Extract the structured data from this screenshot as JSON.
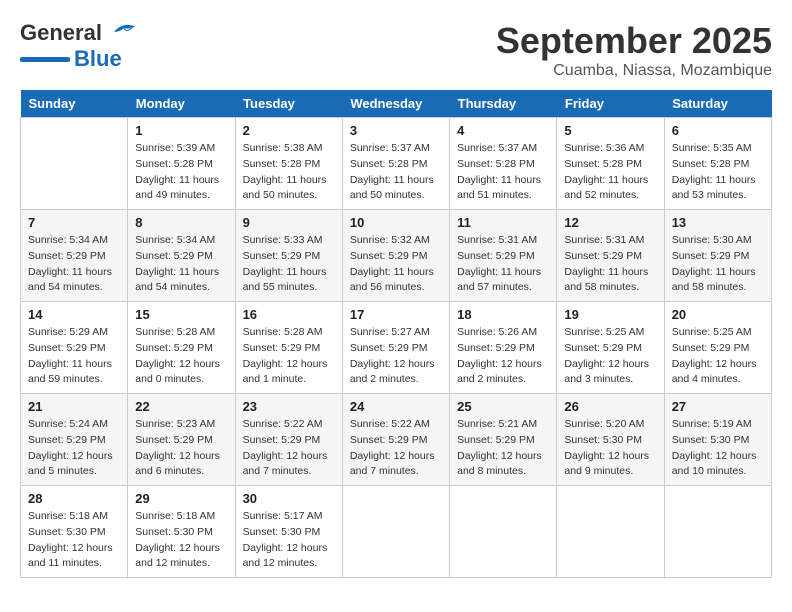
{
  "header": {
    "logo_general": "General",
    "logo_blue": "Blue",
    "month_title": "September 2025",
    "location": "Cuamba, Niassa, Mozambique"
  },
  "weekdays": [
    "Sunday",
    "Monday",
    "Tuesday",
    "Wednesday",
    "Thursday",
    "Friday",
    "Saturday"
  ],
  "weeks": [
    [
      {
        "day": "",
        "sunrise": "",
        "sunset": "",
        "daylight": ""
      },
      {
        "day": "1",
        "sunrise": "Sunrise: 5:39 AM",
        "sunset": "Sunset: 5:28 PM",
        "daylight": "Daylight: 11 hours and 49 minutes."
      },
      {
        "day": "2",
        "sunrise": "Sunrise: 5:38 AM",
        "sunset": "Sunset: 5:28 PM",
        "daylight": "Daylight: 11 hours and 50 minutes."
      },
      {
        "day": "3",
        "sunrise": "Sunrise: 5:37 AM",
        "sunset": "Sunset: 5:28 PM",
        "daylight": "Daylight: 11 hours and 50 minutes."
      },
      {
        "day": "4",
        "sunrise": "Sunrise: 5:37 AM",
        "sunset": "Sunset: 5:28 PM",
        "daylight": "Daylight: 11 hours and 51 minutes."
      },
      {
        "day": "5",
        "sunrise": "Sunrise: 5:36 AM",
        "sunset": "Sunset: 5:28 PM",
        "daylight": "Daylight: 11 hours and 52 minutes."
      },
      {
        "day": "6",
        "sunrise": "Sunrise: 5:35 AM",
        "sunset": "Sunset: 5:28 PM",
        "daylight": "Daylight: 11 hours and 53 minutes."
      }
    ],
    [
      {
        "day": "7",
        "sunrise": "Sunrise: 5:34 AM",
        "sunset": "Sunset: 5:29 PM",
        "daylight": "Daylight: 11 hours and 54 minutes."
      },
      {
        "day": "8",
        "sunrise": "Sunrise: 5:34 AM",
        "sunset": "Sunset: 5:29 PM",
        "daylight": "Daylight: 11 hours and 54 minutes."
      },
      {
        "day": "9",
        "sunrise": "Sunrise: 5:33 AM",
        "sunset": "Sunset: 5:29 PM",
        "daylight": "Daylight: 11 hours and 55 minutes."
      },
      {
        "day": "10",
        "sunrise": "Sunrise: 5:32 AM",
        "sunset": "Sunset: 5:29 PM",
        "daylight": "Daylight: 11 hours and 56 minutes."
      },
      {
        "day": "11",
        "sunrise": "Sunrise: 5:31 AM",
        "sunset": "Sunset: 5:29 PM",
        "daylight": "Daylight: 11 hours and 57 minutes."
      },
      {
        "day": "12",
        "sunrise": "Sunrise: 5:31 AM",
        "sunset": "Sunset: 5:29 PM",
        "daylight": "Daylight: 11 hours and 58 minutes."
      },
      {
        "day": "13",
        "sunrise": "Sunrise: 5:30 AM",
        "sunset": "Sunset: 5:29 PM",
        "daylight": "Daylight: 11 hours and 58 minutes."
      }
    ],
    [
      {
        "day": "14",
        "sunrise": "Sunrise: 5:29 AM",
        "sunset": "Sunset: 5:29 PM",
        "daylight": "Daylight: 11 hours and 59 minutes."
      },
      {
        "day": "15",
        "sunrise": "Sunrise: 5:28 AM",
        "sunset": "Sunset: 5:29 PM",
        "daylight": "Daylight: 12 hours and 0 minutes."
      },
      {
        "day": "16",
        "sunrise": "Sunrise: 5:28 AM",
        "sunset": "Sunset: 5:29 PM",
        "daylight": "Daylight: 12 hours and 1 minute."
      },
      {
        "day": "17",
        "sunrise": "Sunrise: 5:27 AM",
        "sunset": "Sunset: 5:29 PM",
        "daylight": "Daylight: 12 hours and 2 minutes."
      },
      {
        "day": "18",
        "sunrise": "Sunrise: 5:26 AM",
        "sunset": "Sunset: 5:29 PM",
        "daylight": "Daylight: 12 hours and 2 minutes."
      },
      {
        "day": "19",
        "sunrise": "Sunrise: 5:25 AM",
        "sunset": "Sunset: 5:29 PM",
        "daylight": "Daylight: 12 hours and 3 minutes."
      },
      {
        "day": "20",
        "sunrise": "Sunrise: 5:25 AM",
        "sunset": "Sunset: 5:29 PM",
        "daylight": "Daylight: 12 hours and 4 minutes."
      }
    ],
    [
      {
        "day": "21",
        "sunrise": "Sunrise: 5:24 AM",
        "sunset": "Sunset: 5:29 PM",
        "daylight": "Daylight: 12 hours and 5 minutes."
      },
      {
        "day": "22",
        "sunrise": "Sunrise: 5:23 AM",
        "sunset": "Sunset: 5:29 PM",
        "daylight": "Daylight: 12 hours and 6 minutes."
      },
      {
        "day": "23",
        "sunrise": "Sunrise: 5:22 AM",
        "sunset": "Sunset: 5:29 PM",
        "daylight": "Daylight: 12 hours and 7 minutes."
      },
      {
        "day": "24",
        "sunrise": "Sunrise: 5:22 AM",
        "sunset": "Sunset: 5:29 PM",
        "daylight": "Daylight: 12 hours and 7 minutes."
      },
      {
        "day": "25",
        "sunrise": "Sunrise: 5:21 AM",
        "sunset": "Sunset: 5:29 PM",
        "daylight": "Daylight: 12 hours and 8 minutes."
      },
      {
        "day": "26",
        "sunrise": "Sunrise: 5:20 AM",
        "sunset": "Sunset: 5:30 PM",
        "daylight": "Daylight: 12 hours and 9 minutes."
      },
      {
        "day": "27",
        "sunrise": "Sunrise: 5:19 AM",
        "sunset": "Sunset: 5:30 PM",
        "daylight": "Daylight: 12 hours and 10 minutes."
      }
    ],
    [
      {
        "day": "28",
        "sunrise": "Sunrise: 5:18 AM",
        "sunset": "Sunset: 5:30 PM",
        "daylight": "Daylight: 12 hours and 11 minutes."
      },
      {
        "day": "29",
        "sunrise": "Sunrise: 5:18 AM",
        "sunset": "Sunset: 5:30 PM",
        "daylight": "Daylight: 12 hours and 12 minutes."
      },
      {
        "day": "30",
        "sunrise": "Sunrise: 5:17 AM",
        "sunset": "Sunset: 5:30 PM",
        "daylight": "Daylight: 12 hours and 12 minutes."
      },
      {
        "day": "",
        "sunrise": "",
        "sunset": "",
        "daylight": ""
      },
      {
        "day": "",
        "sunrise": "",
        "sunset": "",
        "daylight": ""
      },
      {
        "day": "",
        "sunrise": "",
        "sunset": "",
        "daylight": ""
      },
      {
        "day": "",
        "sunrise": "",
        "sunset": "",
        "daylight": ""
      }
    ]
  ]
}
